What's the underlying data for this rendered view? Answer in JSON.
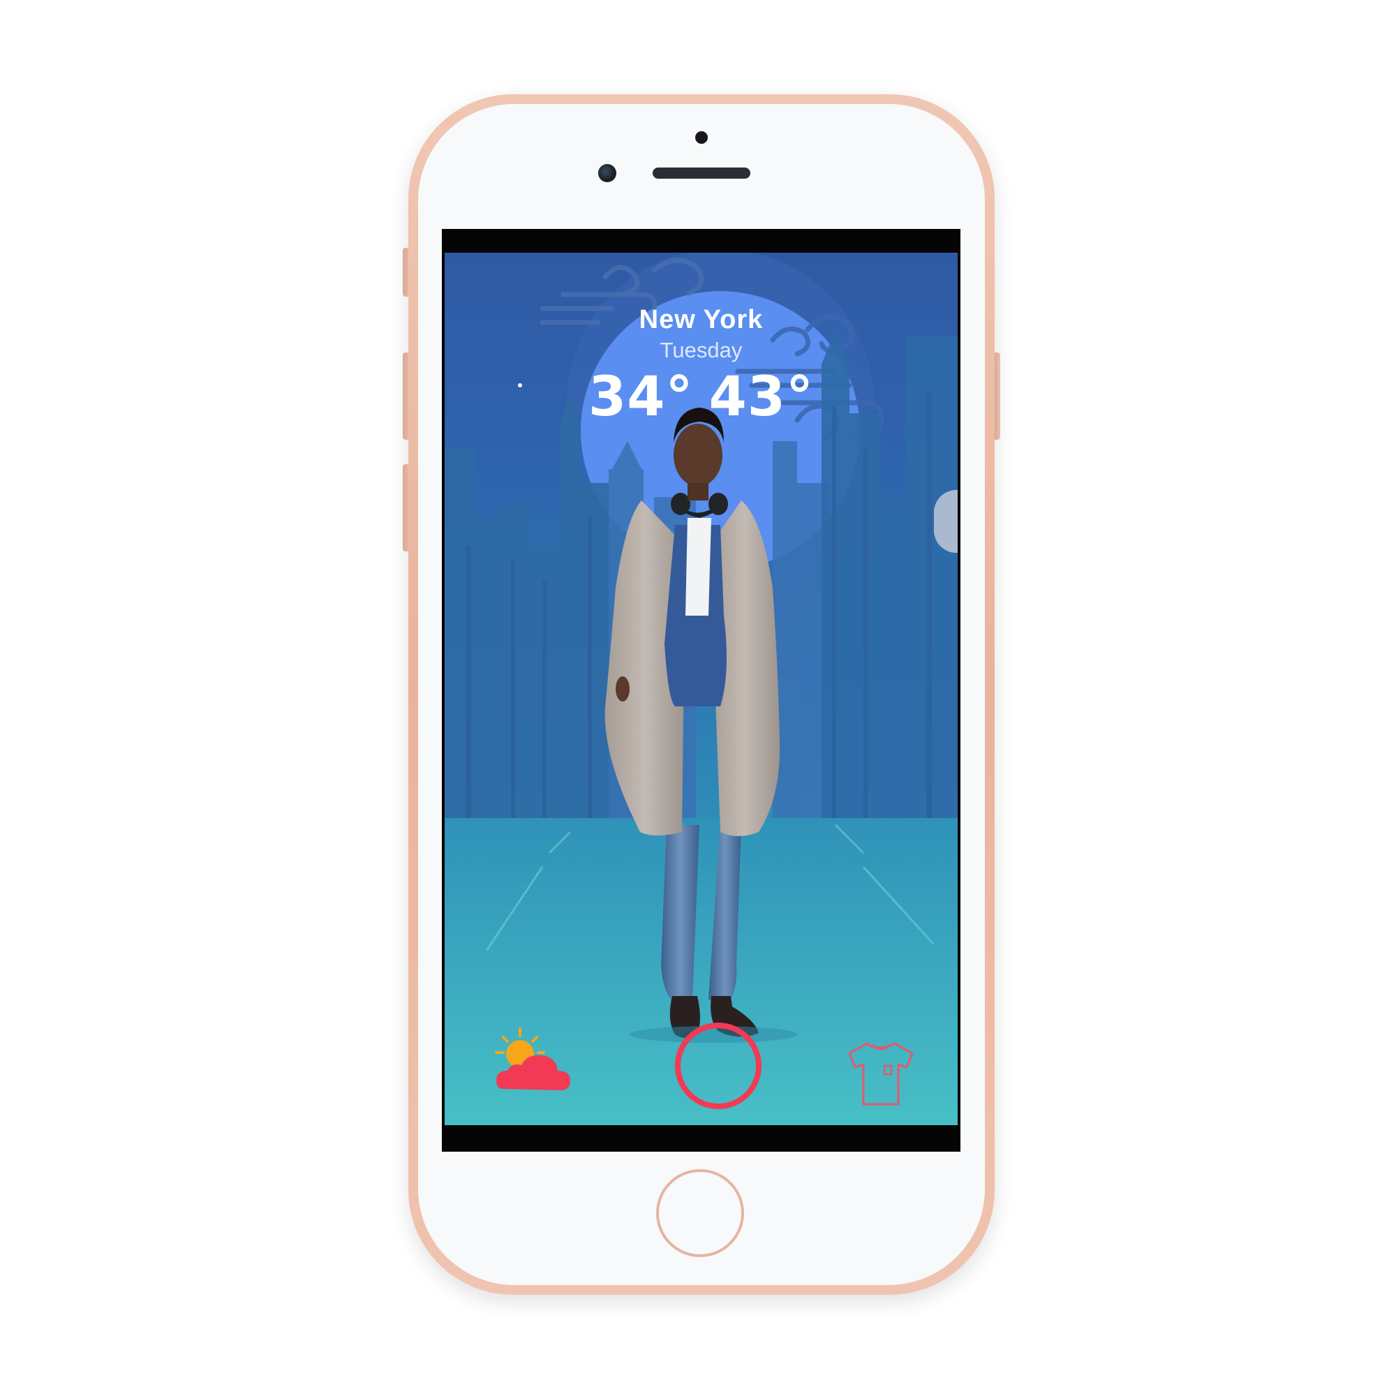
{
  "app": {
    "location": {
      "city": "New York",
      "day": "Tuesday"
    },
    "temperature": {
      "low": "34°",
      "high": "43°"
    }
  },
  "bottom_nav": [
    {
      "name": "weather",
      "icon": "sun-cloud-icon"
    },
    {
      "name": "capture",
      "icon": "circle-record-icon"
    },
    {
      "name": "wardrobe",
      "icon": "tshirt-icon"
    }
  ],
  "colors": {
    "phone_frame": "#e9b39c",
    "screen_top": "#2f5aa3",
    "screen_bottom": "#46bcc4",
    "moon_circle": "#5a8ef0",
    "accent_red": "#f23a55",
    "sun_yellow": "#f6a61a",
    "text": "#ffffff"
  }
}
